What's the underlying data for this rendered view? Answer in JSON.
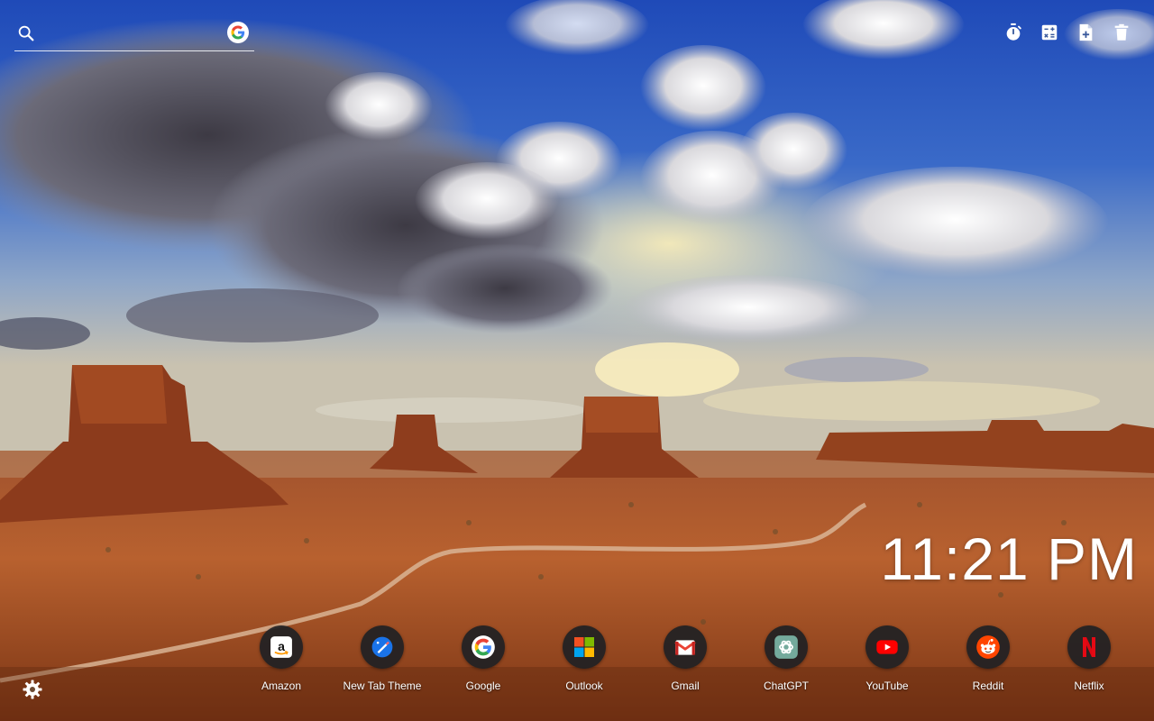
{
  "background": {
    "description_icon": "landscape-wallpaper"
  },
  "search": {
    "placeholder": "",
    "value": "",
    "engine_icon": "google-icon"
  },
  "top_tools": [
    {
      "name": "timer-icon"
    },
    {
      "name": "calculator-icon"
    },
    {
      "name": "add-note-icon"
    },
    {
      "name": "trash-icon"
    }
  ],
  "clock": {
    "time": "11:21 PM"
  },
  "shortcuts": [
    {
      "label": "Amazon",
      "icon": "amazon-icon"
    },
    {
      "label": "New Tab Theme",
      "icon": "new-tab-theme-icon"
    },
    {
      "label": "Google",
      "icon": "google-icon"
    },
    {
      "label": "Outlook",
      "icon": "outlook-icon"
    },
    {
      "label": "Gmail",
      "icon": "gmail-icon"
    },
    {
      "label": "ChatGPT",
      "icon": "chatgpt-icon"
    },
    {
      "label": "YouTube",
      "icon": "youtube-icon"
    },
    {
      "label": "Reddit",
      "icon": "reddit-icon"
    },
    {
      "label": "Netflix",
      "icon": "netflix-icon"
    }
  ],
  "settings": {
    "icon": "gear-icon"
  },
  "colors": {
    "tile_bg": "#202124",
    "google_blue": "#4285F4",
    "google_red": "#EA4335",
    "google_yellow": "#FBBC05",
    "google_green": "#34A853",
    "youtube_red": "#FF0000",
    "reddit_orange": "#FF4500",
    "netflix_red": "#E50914",
    "chatgpt_teal": "#74AA9C"
  }
}
